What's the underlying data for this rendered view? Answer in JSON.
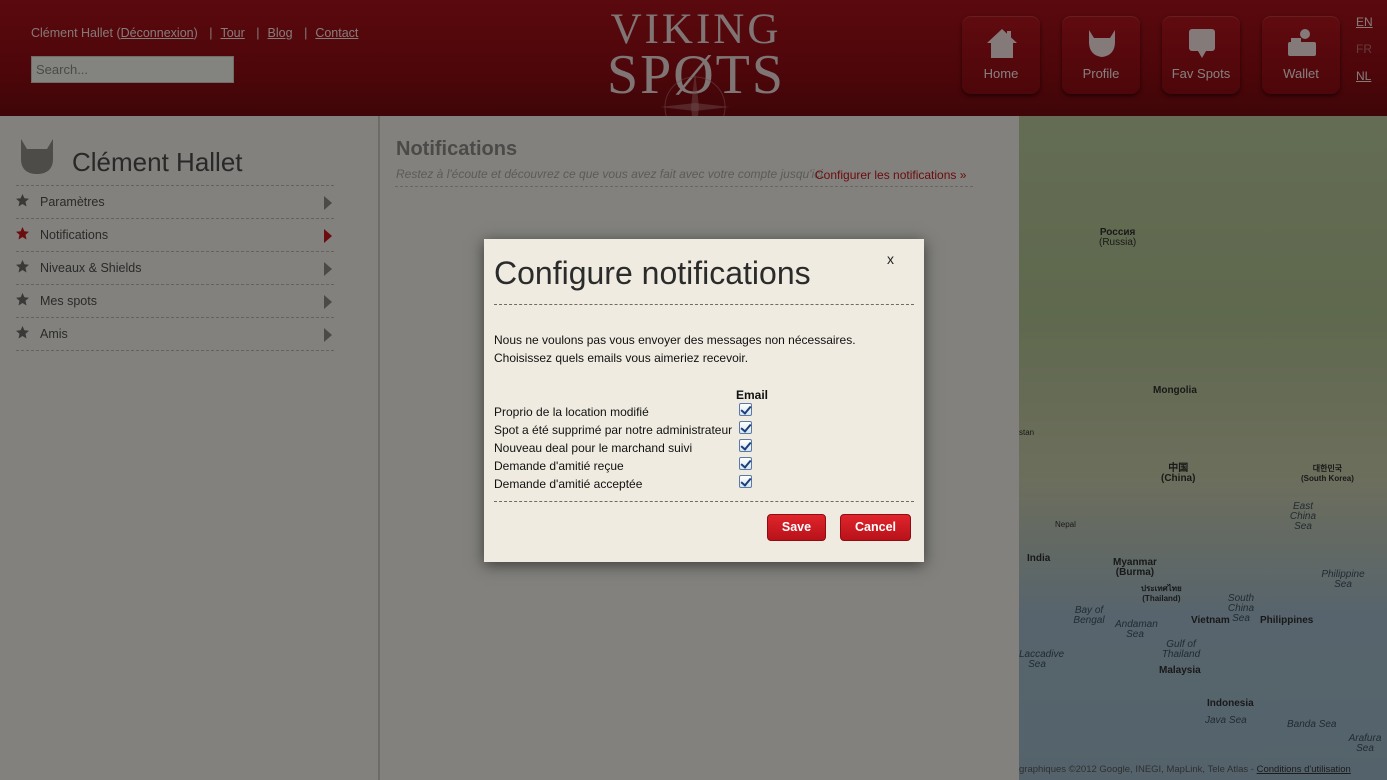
{
  "header": {
    "user_name": "Clément Hallet",
    "logout_label": "Déconnexion",
    "links": [
      "Tour",
      "Blog",
      "Contact"
    ],
    "search_placeholder": "Search...",
    "logo_line1": "VIKING",
    "logo_line2": "SPØTS",
    "nav": [
      {
        "label": "Home",
        "icon": "home-icon"
      },
      {
        "label": "Profile",
        "icon": "profile-icon"
      },
      {
        "label": "Fav Spots",
        "icon": "speech-bubble-icon"
      },
      {
        "label": "Wallet",
        "icon": "wallet-icon"
      }
    ],
    "languages": [
      "EN",
      "FR",
      "NL"
    ],
    "active_language": "FR"
  },
  "sidebar": {
    "profile_name": "Clément Hallet",
    "items": [
      {
        "label": "Paramètres",
        "active": false
      },
      {
        "label": "Notifications",
        "active": true
      },
      {
        "label": "Niveaux & Shields",
        "active": false
      },
      {
        "label": "Mes spots",
        "active": false
      },
      {
        "label": "Amis",
        "active": false
      }
    ]
  },
  "main": {
    "title": "Notifications",
    "subtitle": "Restez à l'écoute et découvrez ce que vous avez fait avec votre compte jusqu'ici.",
    "configure_link": "Configurer les notifications »"
  },
  "map": {
    "labels": [
      {
        "text": "Россия",
        "sub": "(Russia)"
      },
      {
        "text": "Mongolia"
      },
      {
        "text": "中国",
        "sub": "(China)"
      },
      {
        "text": "대한민국",
        "sub": "(South Korea)"
      },
      {
        "text": "Nepal"
      },
      {
        "text": "India"
      },
      {
        "text": "Myanmar",
        "sub": "(Burma)"
      },
      {
        "text": "ประเทศไทย",
        "sub": "(Thailand)"
      },
      {
        "text": "Vietnam"
      },
      {
        "text": "Philippines"
      },
      {
        "text": "Malaysia"
      },
      {
        "text": "Indonesia"
      },
      {
        "text": "East China Sea"
      },
      {
        "text": "South China Sea"
      },
      {
        "text": "Philippine Sea"
      },
      {
        "text": "Bay of Bengal"
      },
      {
        "text": "Andaman Sea"
      },
      {
        "text": "Gulf of Thailand"
      },
      {
        "text": "Java Sea"
      },
      {
        "text": "Banda Sea"
      },
      {
        "text": "Arafura Sea"
      },
      {
        "text": "Laccadive Sea"
      },
      {
        "text": "stan"
      }
    ],
    "attribution": "graphiques ©2012 Google, INEGI, MapLink, Tele Atlas - ",
    "terms_link": "Conditions d'utilisation"
  },
  "modal": {
    "title": "Configure notifications",
    "close_label": "x",
    "intro_line1": "Nous ne voulons pas vous envoyer des messages non nécessaires.",
    "intro_line2": "Choisissez quels emails vous aimeriez recevoir.",
    "column_header": "Email",
    "options": [
      {
        "label": "Proprio de la location modifié",
        "email": true
      },
      {
        "label": "Spot a été supprimé par notre administrateur",
        "email": true
      },
      {
        "label": "Nouveau deal pour le marchand suivi",
        "email": true
      },
      {
        "label": "Demande d'amitié reçue",
        "email": true
      },
      {
        "label": "Demande d'amitié acceptée",
        "email": true
      }
    ],
    "save_label": "Save",
    "cancel_label": "Cancel"
  },
  "colors": {
    "header_red": "#a5121a",
    "accent_red": "#c4161c",
    "panel_bg": "#edebe3",
    "modal_bg": "#efebe0"
  }
}
